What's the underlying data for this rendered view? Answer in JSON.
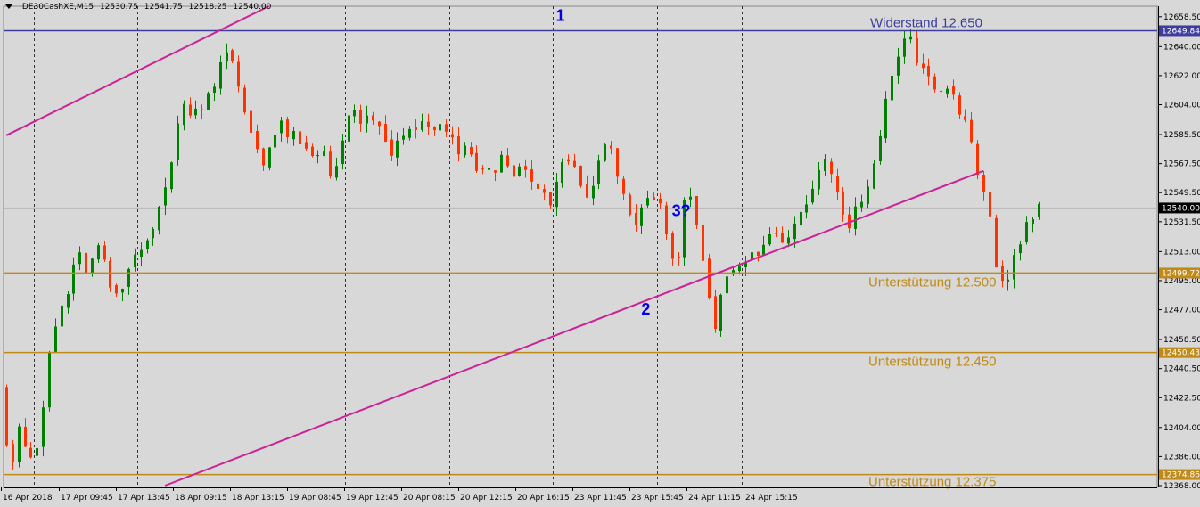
{
  "header": {
    "symbol": ".DE30CashXE,M15",
    "open": "12530.75",
    "high": "12541.75",
    "low": "12518.25",
    "close": "12540.00",
    "menu_icon": "triangle-down-icon"
  },
  "colors": {
    "background": "#d8d8d8",
    "bull": "#008000",
    "bear": "#ff3300",
    "resistance": "#3d3d9e",
    "support": "#c08a18",
    "trendline": "#cc2299",
    "label_blue": "#0000ee",
    "grid": "#333333"
  },
  "chart_data": {
    "type": "candlestick",
    "ylim": [
      12368.0,
      12665.0
    ],
    "bar_count": 170,
    "y_ticks": [
      "12658.50",
      "12640.00",
      "12622.00",
      "12604.00",
      "12585.50",
      "12567.50",
      "12549.50",
      "12531.50",
      "12513.00",
      "12495.00",
      "12477.00",
      "12458.50",
      "12440.50",
      "12422.50",
      "12404.00",
      "12386.00",
      "12368.00"
    ],
    "x_ticks": [
      {
        "label": "16 Apr 2018",
        "bar": 0
      },
      {
        "label": "17 Apr 09:45",
        "bar": 8
      },
      {
        "label": "17 Apr 13:45",
        "bar": 16
      },
      {
        "label": "18 Apr 09:15",
        "bar": 24
      },
      {
        "label": "18 Apr 13:15",
        "bar": 32
      },
      {
        "label": "19 Apr 08:45",
        "bar": 40
      },
      {
        "label": "19 Apr 12:45",
        "bar": 48
      },
      {
        "label": "20 Apr 08:15",
        "bar": 56
      },
      {
        "label": "20 Apr 12:15",
        "bar": 64
      },
      {
        "label": "20 Apr 16:15",
        "bar": 72
      },
      {
        "label": "23 Apr 11:45",
        "bar": 80
      },
      {
        "label": "23 Apr 15:45",
        "bar": 88
      },
      {
        "label": "24 Apr 11:15",
        "bar": 96
      },
      {
        "label": "24 Apr 15:15",
        "bar": 104
      }
    ],
    "session_separators": [
      4.5,
      21.5,
      38.5,
      55.5,
      72.5,
      89.5,
      106.5,
      120.5
    ],
    "levels": [
      {
        "name": "Widerstand 12.650",
        "price": 12649.84,
        "tag": "12649.84",
        "role": "resistance"
      },
      {
        "name": "Unterstützung 12.500",
        "price": 12499.72,
        "tag": "12499.72",
        "role": "support"
      },
      {
        "name": "Unterstützung 12.450",
        "price": 12450.43,
        "tag": "12450.43",
        "role": "support"
      },
      {
        "name": "Unterstützung 12.375",
        "price": 12374.86,
        "tag": "12374.86",
        "role": "support"
      }
    ],
    "current_price": {
      "price": 12540.0,
      "tag": "12540.00"
    },
    "trendlines": [
      {
        "name": "upper-channel-line",
        "p1": {
          "bar": 0,
          "price": 12585.0
        },
        "p2": {
          "bar": 43,
          "price": 12665.0
        }
      },
      {
        "name": "lower-trendline",
        "p1": {
          "bar": 26,
          "price": 12368.0
        },
        "p2": {
          "bar": 160,
          "price": 12563.0
        }
      }
    ],
    "annotations": [
      {
        "text": "1",
        "bar": 90,
        "price": 12656.0
      },
      {
        "text": "2",
        "bar": 104,
        "price": 12474.0
      },
      {
        "text": "3?",
        "bar": 109,
        "price": 12535.0
      }
    ],
    "anchors": [
      [
        0,
        12430
      ],
      [
        1,
        12380
      ],
      [
        2,
        12410
      ],
      [
        3,
        12378
      ],
      [
        4,
        12395
      ],
      [
        5,
        12450
      ],
      [
        6,
        12475
      ],
      [
        7,
        12490
      ],
      [
        8,
        12510
      ],
      [
        9,
        12500
      ],
      [
        10,
        12515
      ],
      [
        11,
        12495
      ],
      [
        12,
        12480
      ],
      [
        13,
        12500
      ],
      [
        14,
        12515
      ],
      [
        15,
        12525
      ],
      [
        16,
        12530
      ],
      [
        17,
        12555
      ],
      [
        18,
        12590
      ],
      [
        19,
        12605
      ],
      [
        20,
        12600
      ],
      [
        21,
        12610
      ],
      [
        22,
        12620
      ],
      [
        23,
        12635
      ],
      [
        24,
        12625
      ],
      [
        25,
        12600
      ],
      [
        26,
        12580
      ],
      [
        27,
        12570
      ],
      [
        28,
        12585
      ],
      [
        29,
        12590
      ],
      [
        30,
        12582
      ],
      [
        31,
        12575
      ],
      [
        32,
        12570
      ],
      [
        33,
        12578
      ],
      [
        34,
        12560
      ],
      [
        35,
        12580
      ],
      [
        36,
        12600
      ],
      [
        37,
        12595
      ],
      [
        38,
        12590
      ],
      [
        39,
        12585
      ],
      [
        40,
        12575
      ],
      [
        41,
        12580
      ],
      [
        42,
        12590
      ],
      [
        43,
        12592
      ],
      [
        44,
        12585
      ],
      [
        45,
        12590
      ],
      [
        46,
        12580
      ],
      [
        47,
        12575
      ],
      [
        48,
        12572
      ],
      [
        49,
        12565
      ],
      [
        50,
        12560
      ],
      [
        51,
        12568
      ],
      [
        52,
        12570
      ],
      [
        53,
        12560
      ],
      [
        54,
        12560
      ],
      [
        55,
        12550
      ],
      [
        56,
        12540
      ],
      [
        57,
        12555
      ],
      [
        58,
        12575
      ],
      [
        59,
        12560
      ],
      [
        60,
        12545
      ],
      [
        61,
        12568
      ],
      [
        62,
        12575
      ],
      [
        63,
        12568
      ],
      [
        64,
        12545
      ],
      [
        65,
        12525
      ],
      [
        66,
        12540
      ],
      [
        67,
        12545
      ],
      [
        68,
        12530
      ],
      [
        69,
        12495
      ],
      [
        70,
        12548
      ],
      [
        71,
        12540
      ],
      [
        72,
        12505
      ],
      [
        73,
        12465
      ],
      [
        74,
        12500
      ],
      [
        75,
        12498
      ],
      [
        76,
        12505
      ],
      [
        77,
        12510
      ],
      [
        78,
        12515
      ],
      [
        79,
        12525
      ],
      [
        80,
        12520
      ],
      [
        81,
        12530
      ],
      [
        82,
        12540
      ],
      [
        83,
        12555
      ],
      [
        84,
        12570
      ],
      [
        85,
        12565
      ],
      [
        86,
        12540
      ],
      [
        87,
        12530
      ],
      [
        88,
        12545
      ],
      [
        89,
        12555
      ],
      [
        90,
        12590
      ],
      [
        91,
        12615
      ],
      [
        92,
        12640
      ],
      [
        93,
        12645
      ],
      [
        94,
        12630
      ],
      [
        95,
        12620
      ],
      [
        96,
        12615
      ],
      [
        97,
        12610
      ],
      [
        98,
        12600
      ],
      [
        99,
        12590
      ],
      [
        100,
        12560
      ],
      [
        101,
        12540
      ],
      [
        102,
        12500
      ],
      [
        103,
        12495
      ],
      [
        104,
        12510
      ],
      [
        105,
        12532
      ],
      [
        106,
        12540
      ]
    ],
    "bar_anchor_scale": 1.6
  }
}
